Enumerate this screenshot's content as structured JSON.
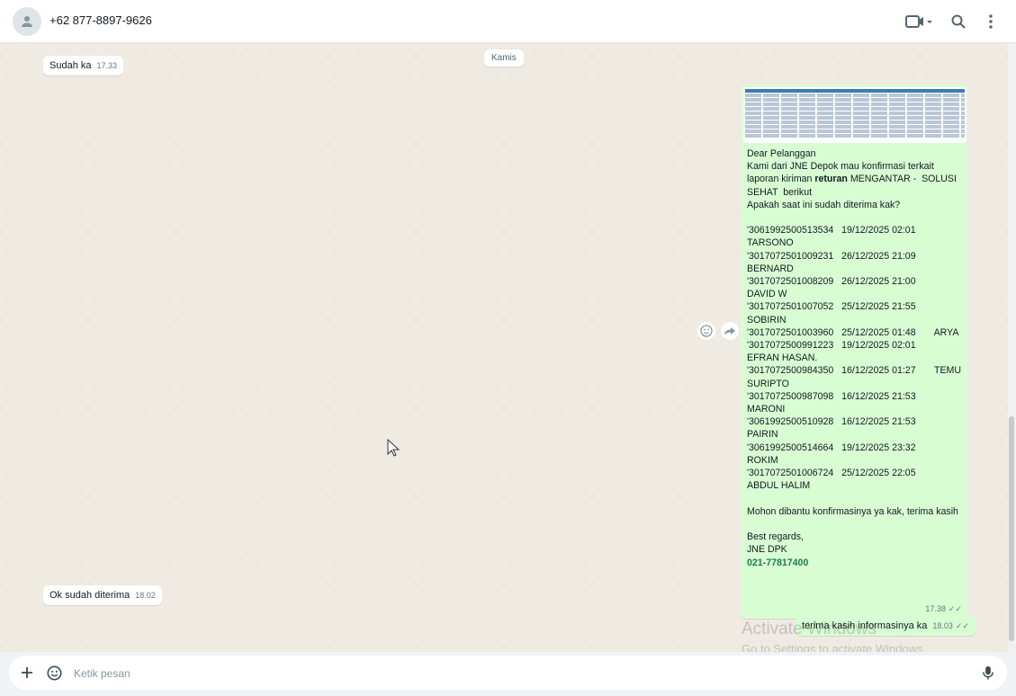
{
  "header": {
    "contact": "+62 877-8897-9626",
    "icons": [
      "person-icon",
      "video-call-icon",
      "search-icon",
      "more-options-icon"
    ]
  },
  "chat": {
    "day_label": "Kamis",
    "messages": [
      {
        "direction": "in",
        "text": "Sudah ka",
        "time": "17.33"
      },
      {
        "direction": "out",
        "has_image": true,
        "text": "Dear Pelanggan\nKami dari JNE Depok mau konfirmasi terkait\nlaporan kiriman ",
        "bold": "returan",
        "text2": " MENGANTAR -  SOLUSI\nSEHAT  berikut\nApakah saat ini sudah diterima kak?\n\n'3061992500513534   19/12/2025 02:01\nTARSONO\n'3017072501009231   26/12/2025 21:09\nBERNARD\n'3017072501008209   26/12/2025 21:00\nDAVID W\n'3017072501007052   25/12/2025 21:55\nSOBIRIN\n'3017072501003960   25/12/2025 01:48       ARYA\n'3017072500991223   19/12/2025 02:01\nEFRAN HASAN.\n'3017072500984350   16/12/2025 01:27       TEMU\nSURIPTO\n'3017072500987098   16/12/2025 21:53\nMARONI\n'3061992500510928   16/12/2025 21:53\nPAIRIN\n'3061992500514664   19/12/2025 23:32\nROKIM\n'3017072501006724   25/12/2025 22:05\nABDUL HALIM\n\nMohon dibantu konfirmasinya ya kak, terima kasih\n\nBest regards,\nJNE DPK",
        "phone": "021-77817400",
        "time": "17.38",
        "status": "read"
      },
      {
        "direction": "in",
        "text": "Ok sudah diterima",
        "time": "18.02"
      },
      {
        "direction": "out",
        "text": "terima kasih informasinya ka",
        "time": "18.03",
        "status": "read"
      }
    ],
    "reaction_icons": [
      "emoji-react-icon",
      "forward-icon"
    ]
  },
  "watermark": {
    "line1": "Activate Windows",
    "line2": "Go to Settings to activate Windows."
  },
  "composer": {
    "placeholder": "Ketik pesan",
    "icons": [
      "plus-icon",
      "sticker-icon",
      "microphone-icon"
    ]
  },
  "colors": {
    "chat_bg": "#efeae2",
    "outgoing_bubble": "#d9fdd3",
    "incoming_bubble": "#ffffff",
    "link_green": "#1c7c4c"
  }
}
